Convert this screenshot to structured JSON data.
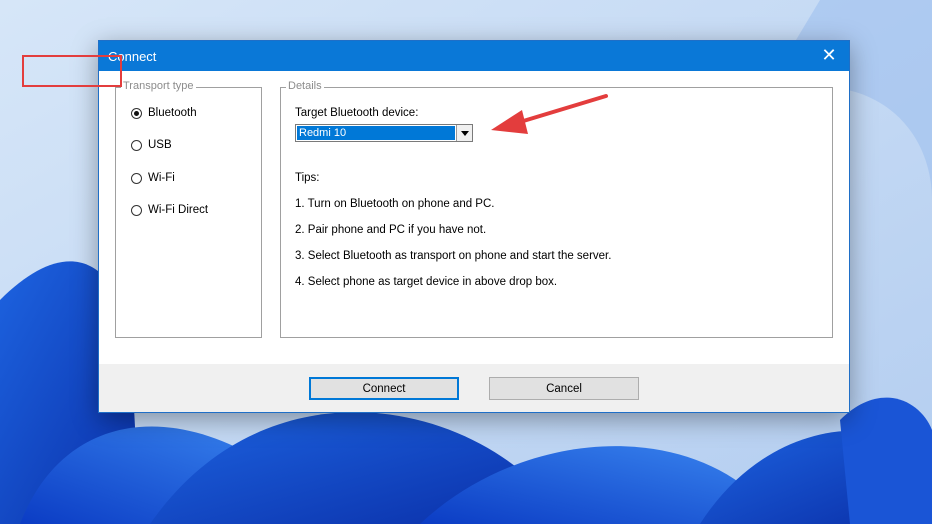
{
  "dialog": {
    "title": "Connect",
    "close_glyph": "✕"
  },
  "transport": {
    "legend": "Transport type",
    "options": [
      {
        "label": "Bluetooth",
        "checked": true
      },
      {
        "label": "USB",
        "checked": false
      },
      {
        "label": "Wi-Fi",
        "checked": false
      },
      {
        "label": "Wi-Fi Direct",
        "checked": false
      }
    ]
  },
  "details": {
    "legend": "Details",
    "target_label": "Target Bluetooth device:",
    "selected_device": "Redmi 10",
    "tips_heading": "Tips:",
    "tips": [
      "1. Turn on Bluetooth on phone and PC.",
      "2. Pair phone and PC if you have not.",
      "3. Select Bluetooth as transport on phone and start the server.",
      "4. Select phone as target device in above drop box."
    ]
  },
  "buttons": {
    "connect": "Connect",
    "cancel": "Cancel"
  },
  "colors": {
    "titlebar": "#0a78d7",
    "selection": "#0078d7",
    "annotation": "#e33d3d"
  }
}
